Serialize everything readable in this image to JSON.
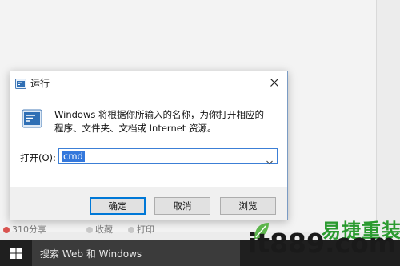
{
  "background": {
    "strip_items": [
      "310分享",
      "收藏",
      "打印"
    ]
  },
  "dialog": {
    "title": "运行",
    "description": "Windows 将根据你所输入的名称，为你打开相应的程序、文件夹、文档或 Internet 资源。",
    "open_label": "打开(O):",
    "input_value": "cmd",
    "buttons": {
      "ok": "确定",
      "cancel": "取消",
      "browse": "浏览"
    }
  },
  "taskbar": {
    "search_text": "搜索 Web 和 Windows"
  },
  "watermark": {
    "url": "it889.com",
    "brand": "易捷重装"
  },
  "colors": {
    "accent": "#0078d7",
    "taskbar": "#1f1f1f",
    "red_line": "#d46060",
    "watermark_green": "#2a9a2f"
  }
}
